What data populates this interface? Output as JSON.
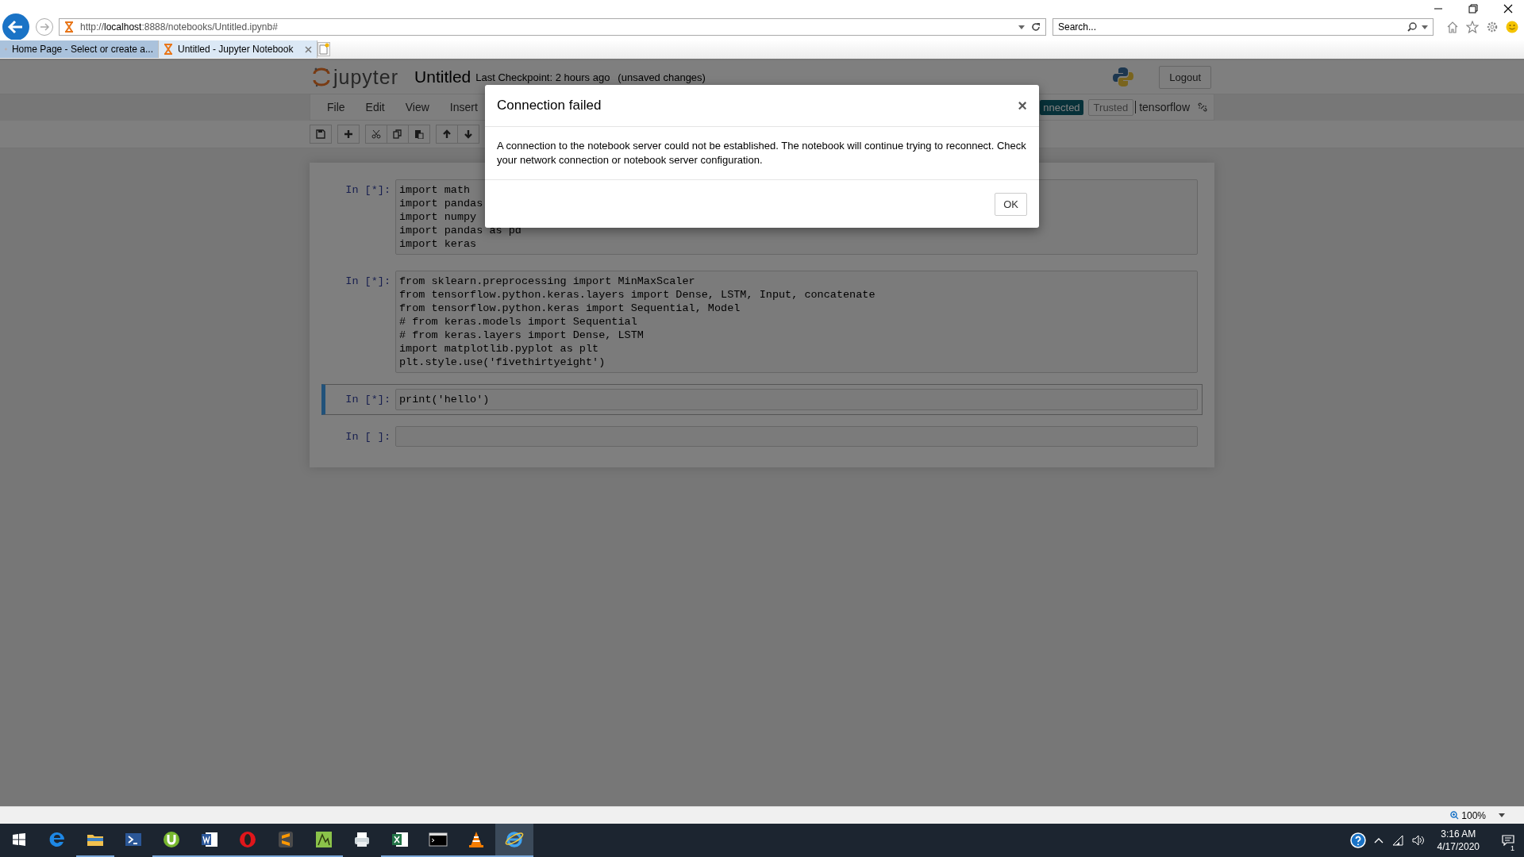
{
  "browser": {
    "url": "http://**localhost**:8888/notebooks/Untitled.ipynb#",
    "search": {
      "placeholder": "Search..."
    },
    "tabs": [
      {
        "label": "Home Page - Select or create a...",
        "selected": false
      },
      {
        "label": "Untitled - Jupyter Notebook",
        "selected": true
      }
    ]
  },
  "notebook": {
    "logo_text": "jupyter",
    "title": "Untitled",
    "checkpoint": "Last Checkpoint: 2 hours ago",
    "unsaved": "(unsaved changes)",
    "logout": "Logout",
    "menu": [
      "File",
      "Edit",
      "View",
      "Insert"
    ],
    "status": {
      "connection": "nnected",
      "trusted": "Trusted",
      "kernel": "tensorflow"
    },
    "cells": [
      {
        "prompt": "In [*]:",
        "selected": false,
        "code": [
          "import math",
          "import pandas",
          "import numpy",
          "import pandas as pd",
          "import keras"
        ]
      },
      {
        "prompt": "In [*]:",
        "selected": false,
        "code": [
          "from sklearn.preprocessing import MinMaxScaler",
          "from tensorflow.python.keras.layers import Dense, LSTM, Input, concatenate",
          "from tensorflow.python.keras import Sequential, Model",
          "# from keras.models import Sequential",
          "# from keras.layers import Dense, LSTM",
          "import matplotlib.pyplot as plt",
          "plt.style.use('fivethirtyeight')"
        ]
      },
      {
        "prompt": "In [*]:",
        "selected": true,
        "code": [
          "print('hello')"
        ]
      },
      {
        "prompt": "In [ ]:",
        "selected": false
      }
    ]
  },
  "dialog": {
    "title": "Connection failed",
    "close": "×",
    "message": "A connection to the notebook server could not be established. The notebook will continue trying to reconnect. Check your network connection or notebook server configuration.",
    "button": "OK"
  },
  "status_bar": {
    "zoom": "100%"
  },
  "taskbar": {
    "apps": [
      {
        "kind": "edge",
        "running": false,
        "selected": false
      },
      {
        "kind": "folder",
        "running": true,
        "selected": false
      },
      {
        "kind": "shell",
        "running": false,
        "selected": false
      },
      {
        "kind": "torrent",
        "running": true,
        "selected": false
      },
      {
        "kind": "word",
        "running": true,
        "selected": false
      },
      {
        "kind": "opera",
        "running": true,
        "selected": false
      },
      {
        "kind": "sublime",
        "running": true,
        "selected": false
      },
      {
        "kind": "chart",
        "running": true,
        "selected": false
      },
      {
        "kind": "printer",
        "running": false,
        "selected": false
      },
      {
        "kind": "excel",
        "running": true,
        "selected": false
      },
      {
        "kind": "terminal",
        "running": true,
        "selected": false
      },
      {
        "kind": "cone",
        "running": true,
        "selected": false
      },
      {
        "kind": "ie",
        "running": true,
        "selected": true
      }
    ],
    "time": "3:16 AM",
    "date": "4/17/2020",
    "notifications": "1"
  }
}
